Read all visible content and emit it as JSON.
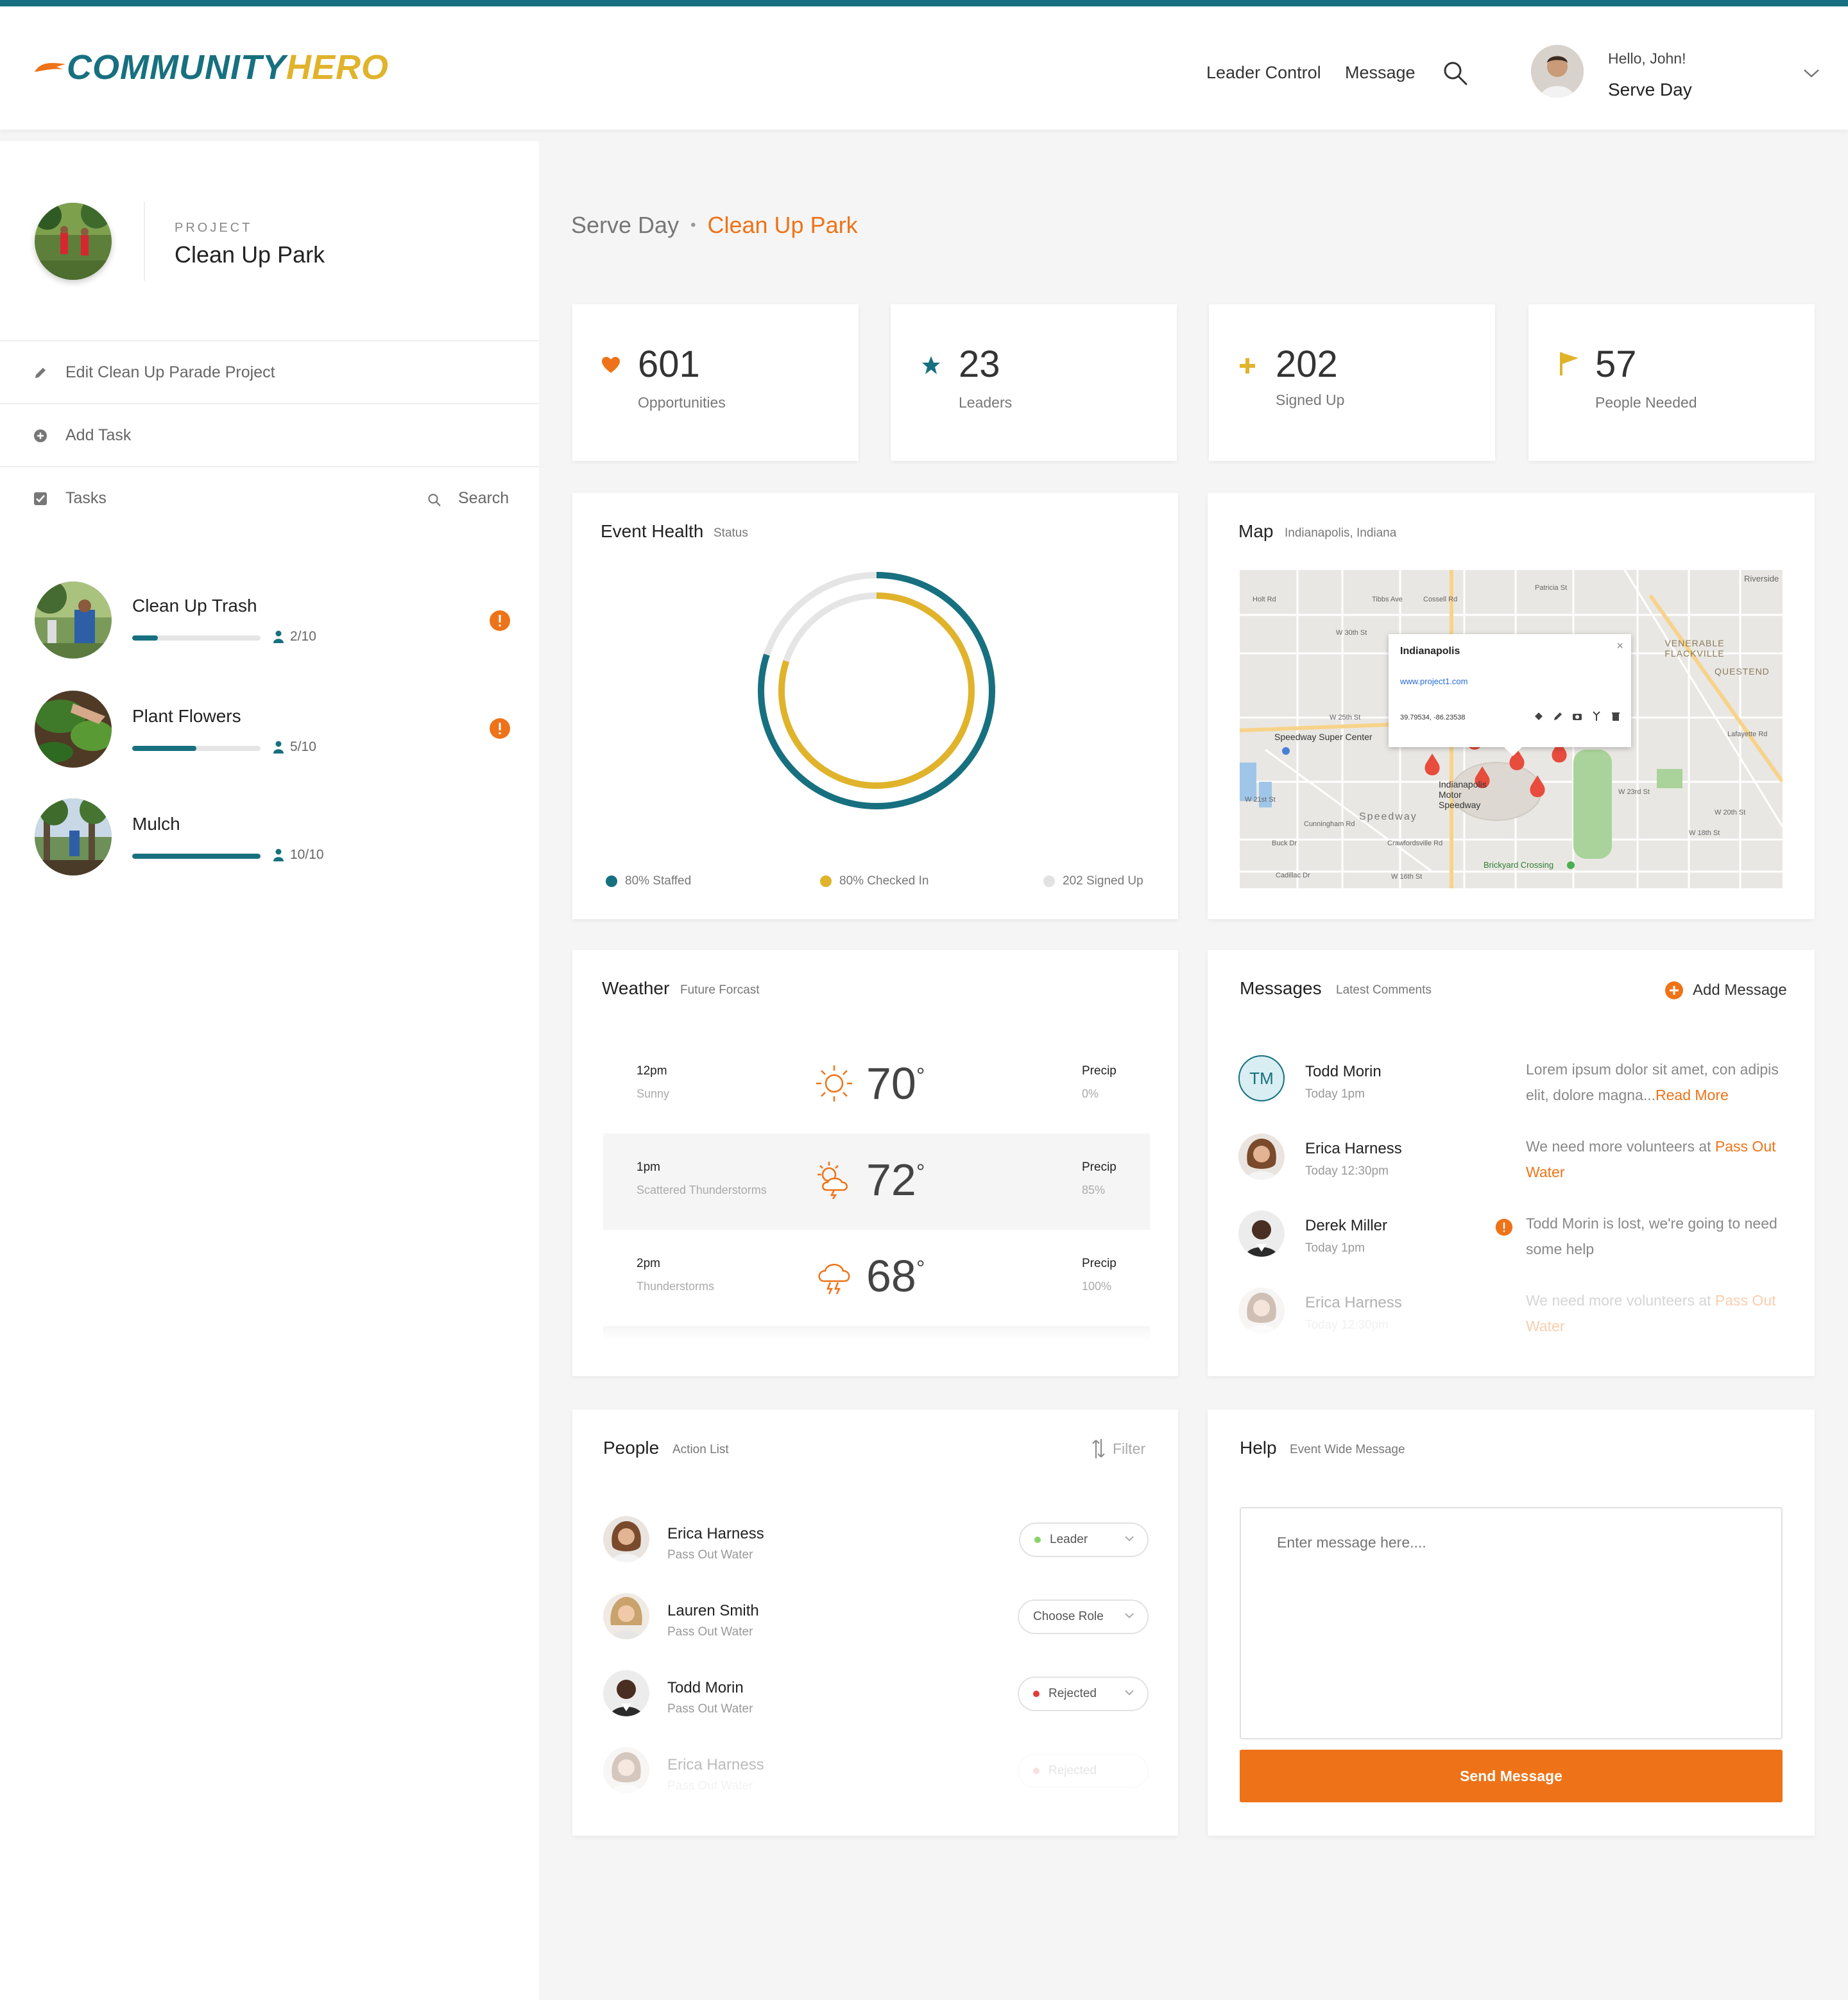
{
  "header": {
    "brand_part1": "COMMUNITY",
    "brand_part2": "HERO",
    "nav": [
      "Leader Control",
      "Message"
    ],
    "greeting": "Hello, John!",
    "event": "Serve Day"
  },
  "sidebar": {
    "project_label": "PROJECT",
    "project_name": "Clean Up Park",
    "menu": [
      {
        "label": "Edit Clean Up Parade Project",
        "icon": "pencil-icon"
      },
      {
        "label": "Add Task",
        "icon": "plus-circle-icon"
      },
      {
        "label": "Tasks",
        "icon": "checkbox-icon"
      }
    ],
    "search_label": "Search",
    "tasks": [
      {
        "name": "Clean Up Trash",
        "count": "2/10",
        "progress": 0.2,
        "alert": true
      },
      {
        "name": "Plant Flowers",
        "count": "5/10",
        "progress": 0.5,
        "alert": true
      },
      {
        "name": "Mulch",
        "count": "10/10",
        "progress": 1.0,
        "alert": false
      }
    ]
  },
  "breadcrumb": {
    "parent": "Serve Day",
    "separator": "•",
    "current": "Clean Up Park"
  },
  "stats": [
    {
      "value": "601",
      "label": "Opportunities",
      "icon": "heart-icon",
      "color": "#ee7318"
    },
    {
      "value": "23",
      "label": "Leaders",
      "icon": "star-icon",
      "color": "#17707f"
    },
    {
      "value": "202",
      "label": "Signed Up",
      "icon": "plus-icon",
      "color": "#e0b32b"
    },
    {
      "value": "57",
      "label": "People Needed",
      "icon": "flag-icon",
      "color": "#e0b32b"
    }
  ],
  "event_health": {
    "title": "Event Health",
    "subtitle": "Status",
    "legend": [
      {
        "label": "80% Staffed",
        "color": "#17707f",
        "value": 0.8
      },
      {
        "label": "80% Checked In",
        "color": "#e0b32b",
        "value": 0.8
      },
      {
        "label": "202 Signed Up",
        "color": "#e2e2e2",
        "value": 1.0
      }
    ]
  },
  "map": {
    "title": "Map",
    "subtitle": "Indianapolis, Indiana",
    "popup_title": "Indianapolis",
    "popup_link": "www.project1.com",
    "popup_coords": "39.79534, -86.23538",
    "places": [
      "Speedway Super Center",
      "Indianapolis Motor Speedway",
      "Brickyard Crossing",
      "VENERABLE FLACKVILLE",
      "QUESTEND",
      "Riverside",
      "Speedway"
    ],
    "streets": [
      "W 30th St",
      "W 25th St",
      "W 21st St",
      "W 16th St",
      "W 18th St",
      "W 20th St",
      "W 23rd St",
      "Cossell Rd",
      "Lafayette Rd",
      "Crawfordsville Rd",
      "Cunningham Rd",
      "Buck Dr",
      "Cadillac Dr",
      "Patricia St",
      "Tibbs Ave",
      "Holt Rd"
    ]
  },
  "weather": {
    "title": "Weather",
    "subtitle": "Future Forcast",
    "precip_label": "Precip",
    "rows": [
      {
        "time": "12pm",
        "cond": "Sunny",
        "temp": "70",
        "precip": "0%",
        "icon": "sun-icon"
      },
      {
        "time": "1pm",
        "cond": "Scattered Thunderstorms",
        "temp": "72",
        "precip": "85%",
        "icon": "partly-stormy-icon"
      },
      {
        "time": "2pm",
        "cond": "Thunderstorms",
        "temp": "68",
        "precip": "100%",
        "icon": "storm-cloud-icon"
      }
    ],
    "degree": "°"
  },
  "messages": {
    "title": "Messages",
    "subtitle": "Latest Comments",
    "add_label": "Add Message",
    "read_more": "Read More",
    "items": [
      {
        "name": "Todd Morin",
        "time": "Today 1pm",
        "initials": "TM",
        "text": "Lorem ipsum dolor sit amet, con adipis elit,  dolore magna...",
        "link": "Read More"
      },
      {
        "name": "Erica Harness",
        "time": "Today 12:30pm",
        "text": "We need more volunteers at ",
        "link": "Pass Out Water"
      },
      {
        "name": "Derek Miller",
        "time": "Today 1pm",
        "text": "Todd Morin is lost, we're going to need some help",
        "alert": true
      },
      {
        "name": "Erica Harness",
        "time": "Today 12:30pm",
        "text": "We need more volunteers at ",
        "link": "Pass Out Water"
      }
    ]
  },
  "people": {
    "title": "People",
    "subtitle": "Action List",
    "filter_label": "Filter",
    "items": [
      {
        "name": "Erica Harness",
        "task": "Pass Out Water",
        "role": "Leader",
        "dot": "#8bd16a"
      },
      {
        "name": "Lauren Smith",
        "task": "Pass Out Water",
        "role": "Choose Role",
        "dot": ""
      },
      {
        "name": "Todd Morin",
        "task": "Pass Out Water",
        "role": "Rejected",
        "dot": "#e23b3b"
      },
      {
        "name": "Erica Harness",
        "task": "Pass Out Water",
        "role": "Rejected",
        "dot": "#e23b3b"
      }
    ]
  },
  "help": {
    "title": "Help",
    "subtitle": "Event Wide Message",
    "placeholder": "Enter message here....",
    "button": "Send Message"
  }
}
